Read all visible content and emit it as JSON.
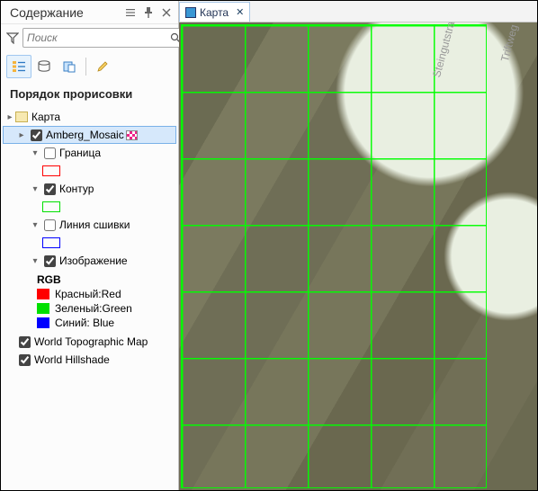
{
  "panel": {
    "title": "Содержание",
    "search_placeholder": "Поиск",
    "section_title": "Порядок прорисовки"
  },
  "tree": {
    "map_label": "Карта",
    "mosaic_label": "Amberg_Mosaic",
    "boundary_label": "Граница",
    "contour_label": "Контур",
    "seamline_label": "Линия сшивки",
    "image_label": "Изображение",
    "rgb_label": "RGB",
    "red_label": "Красный:Red",
    "green_label": "Зеленый:Green",
    "blue_label": "Синий: Blue",
    "topo_label": "World Topographic Map",
    "hillshade_label": "World Hillshade"
  },
  "colors": {
    "boundary": "#ff0000",
    "contour": "#00e000",
    "seamline": "#0000ff",
    "red": "#ff0000",
    "green": "#00e000",
    "blue": "#0000ff"
  },
  "tab": {
    "label": "Карта"
  },
  "streets": {
    "s1": "Steingutstraße",
    "s2": "Triftweg"
  }
}
